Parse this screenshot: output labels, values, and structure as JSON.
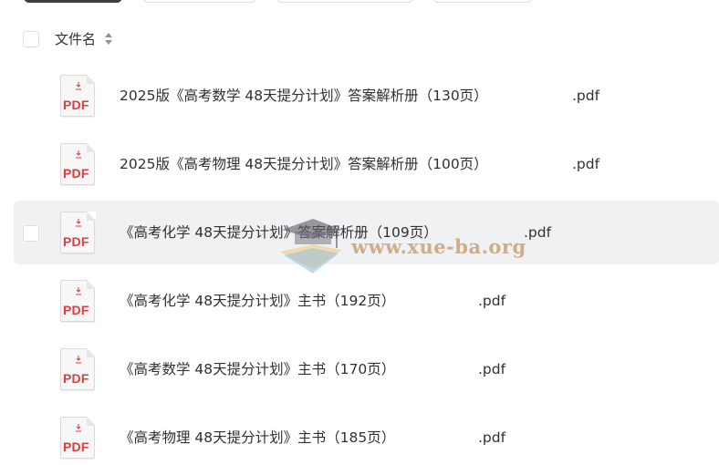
{
  "header": {
    "column_label": "文件名"
  },
  "files": [
    {
      "name": "2025版《高考数学  48天提分计划》答案解析册（130页）",
      "ext": ".pdf",
      "icon_label": "PDF"
    },
    {
      "name": "2025版《高考物理  48天提分计划》答案解析册（100页）",
      "ext": ".pdf",
      "icon_label": "PDF"
    },
    {
      "name": "《高考化学  48天提分计划》答案解析册（109页）",
      "ext": ".pdf",
      "icon_label": "PDF"
    },
    {
      "name": "《高考化学  48天提分计划》主书（192页）",
      "ext": ".pdf",
      "icon_label": "PDF"
    },
    {
      "name": "《高考数学  48天提分计划》主书（170页）",
      "ext": ".pdf",
      "icon_label": "PDF"
    },
    {
      "name": "《高考物理  48天提分计划》主书（185页）",
      "ext": ".pdf",
      "icon_label": "PDF"
    }
  ],
  "watermark": {
    "text": "www.xue-ba.org"
  },
  "colors": {
    "pdf_red": "#e23b3b",
    "hover_row": "#f0f1f3",
    "text": "#303133"
  }
}
